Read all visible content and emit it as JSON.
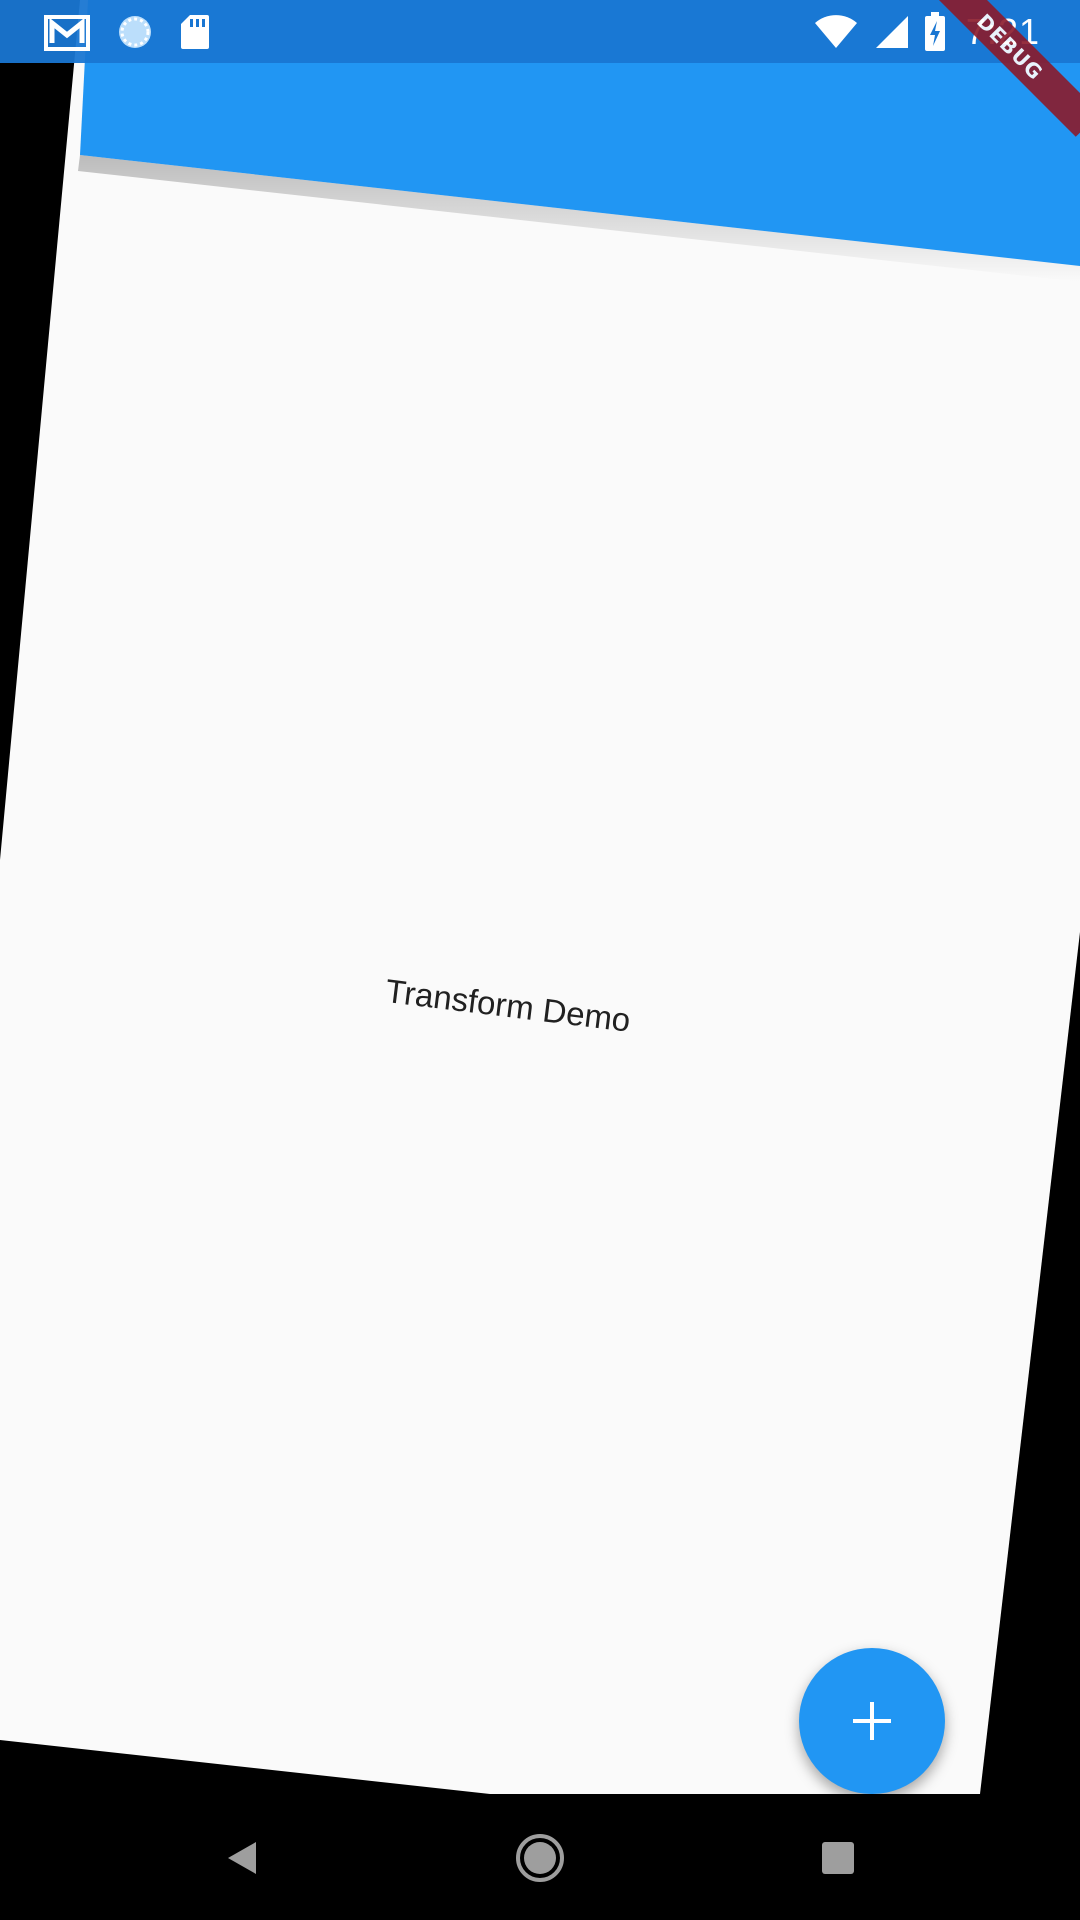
{
  "status_bar": {
    "time": "7:21",
    "icons": [
      "gmail-icon",
      "sync-icon",
      "sd-card-icon",
      "wifi-icon",
      "signal-icon",
      "battery-charging-icon"
    ]
  },
  "debug_banner": {
    "label": "DEBUG"
  },
  "main": {
    "center_text": "Transform Demo"
  },
  "fab": {
    "icon": "plus-icon"
  },
  "nav_bar": {
    "buttons": [
      "back-icon",
      "home-icon",
      "recents-icon"
    ]
  },
  "colors": {
    "primary": "#2196f3",
    "app_bar": "#2196f3",
    "background": "#fafafa",
    "debug_banner": "#8b1a2b",
    "outside": "#000000"
  }
}
